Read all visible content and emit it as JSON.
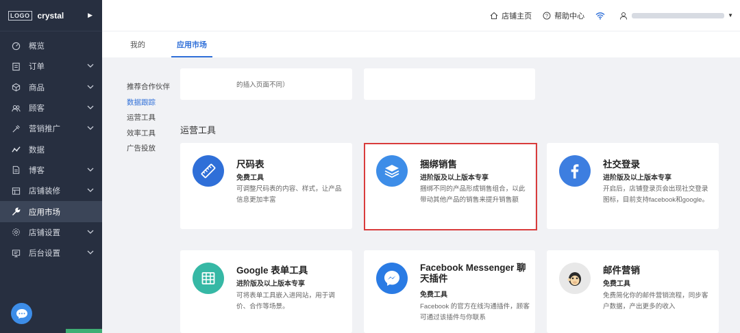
{
  "sidebar": {
    "logo": "LOGO",
    "store_name": "crystal",
    "items": [
      {
        "label": "概览",
        "icon": "dashboard-icon",
        "expandable": false,
        "active": false
      },
      {
        "label": "订单",
        "icon": "order-icon",
        "expandable": true,
        "active": false
      },
      {
        "label": "商品",
        "icon": "product-box-icon",
        "expandable": true,
        "active": false
      },
      {
        "label": "顾客",
        "icon": "customers-icon",
        "expandable": true,
        "active": false
      },
      {
        "label": "营销推广",
        "icon": "marketing-icon",
        "expandable": true,
        "active": false
      },
      {
        "label": "数据",
        "icon": "analytics-icon",
        "expandable": false,
        "active": false
      },
      {
        "label": "博客",
        "icon": "blog-icon",
        "expandable": true,
        "active": false
      },
      {
        "label": "店铺装修",
        "icon": "store-design-icon",
        "expandable": true,
        "active": false
      },
      {
        "label": "应用市场",
        "icon": "wrench-icon",
        "expandable": false,
        "active": true
      },
      {
        "label": "店铺设置",
        "icon": "settings-icon",
        "expandable": true,
        "active": false
      },
      {
        "label": "后台设置",
        "icon": "admin-icon",
        "expandable": true,
        "active": false
      }
    ]
  },
  "topbar": {
    "store_home": "店铺主页",
    "help_center": "帮助中心"
  },
  "tabs": [
    {
      "label": "我的",
      "active": false
    },
    {
      "label": "应用市场",
      "active": true
    }
  ],
  "filter": {
    "items": [
      "推荐合作伙伴",
      "数据跟踪",
      "运营工具",
      "效率工具",
      "广告投放"
    ],
    "active_index": 1
  },
  "partial_card": {
    "desc_tail": "的插入页面不同）"
  },
  "section": {
    "title": "运营工具"
  },
  "cards": [
    {
      "title": "尺码表",
      "tag": "免费工具",
      "desc": "可调整尺码表的内容、样式，让产品信息更加丰富",
      "icon": "ruler-icon",
      "color": "#2f6fd8"
    },
    {
      "title": "捆绑销售",
      "tag": "进阶版及以上版本专享",
      "desc": "捆绑不同的产品形成销售组合，以此带动其他产品的销售来提升销售额",
      "icon": "layers-icon",
      "color": "#3d8de8"
    },
    {
      "title": "社交登录",
      "tag": "进阶版及以上版本专享",
      "desc": "开启后，店铺登录页会出现社交登录图标，目前支持facebook和google。",
      "icon": "facebook-icon",
      "color": "#3d7ee0"
    },
    {
      "title": "Google 表单工具",
      "tag": "进阶版及以上版本专享",
      "desc": "可将表单工具嵌入进网站，用于调价、合作等场景。",
      "icon": "spreadsheet-icon",
      "color": "#36b8a5"
    },
    {
      "title": "Facebook Messenger 聊天插件",
      "tag": "免费工具",
      "desc": "Facebook 的官方在线沟通插件，顾客可通过该插件与你联系",
      "icon": "messenger-icon",
      "color": "#2a7be4"
    },
    {
      "title": "邮件营销",
      "tag": "免费工具",
      "desc": "免费简化你的邮件营销流程，同步客户数据，产出更多的收入",
      "icon": "mailchimp-icon",
      "color": "#e8e8e8"
    }
  ],
  "highlight_card_index": 1,
  "colors": {
    "accent": "#2f6fd8",
    "sidebar_bg": "#272f40",
    "highlight": "#d93b3b"
  }
}
